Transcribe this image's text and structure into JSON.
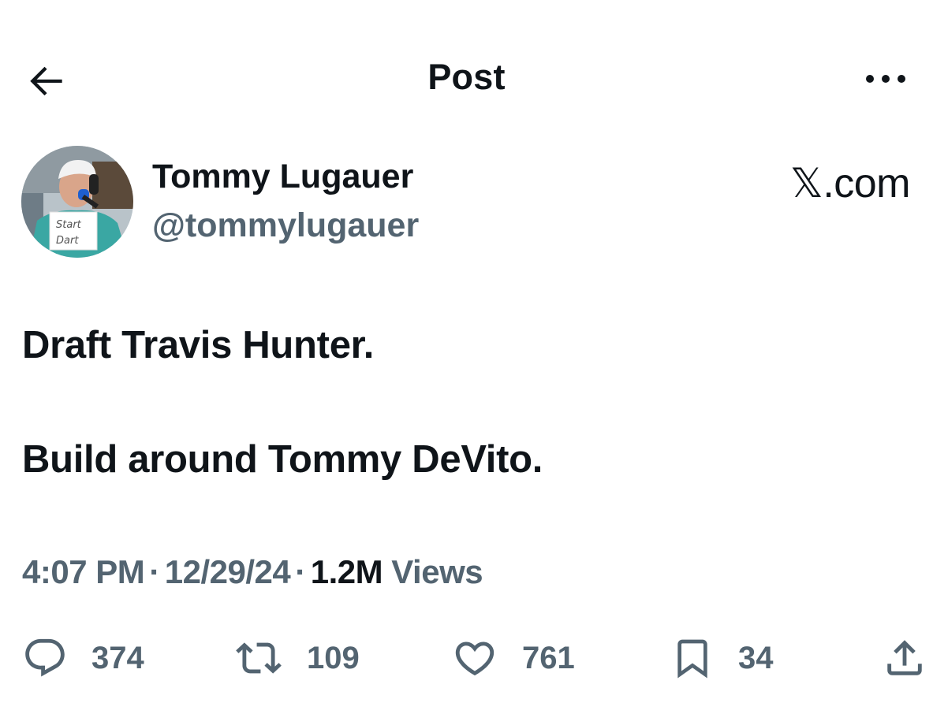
{
  "header": {
    "title": "Post",
    "back_icon": "arrow-left-icon",
    "more_icon": "more-horizontal-icon"
  },
  "author": {
    "name": "Tommy Lugauer",
    "handle": "@tommylugauer",
    "avatar_sign_text": "Start Dart"
  },
  "source": {
    "label": "𝕏.com"
  },
  "post": {
    "lines": [
      "Draft Travis Hunter.",
      "Build around Tommy DeVito."
    ]
  },
  "meta": {
    "time": "4:07 PM",
    "date": "12/29/24",
    "separator": "·",
    "views_count": "1.2M",
    "views_label": "Views"
  },
  "actions": {
    "replies": "374",
    "reposts": "109",
    "likes": "761",
    "bookmarks": "34"
  },
  "colors": {
    "text_primary": "#0f1419",
    "text_secondary": "#536471",
    "background": "#ffffff"
  }
}
